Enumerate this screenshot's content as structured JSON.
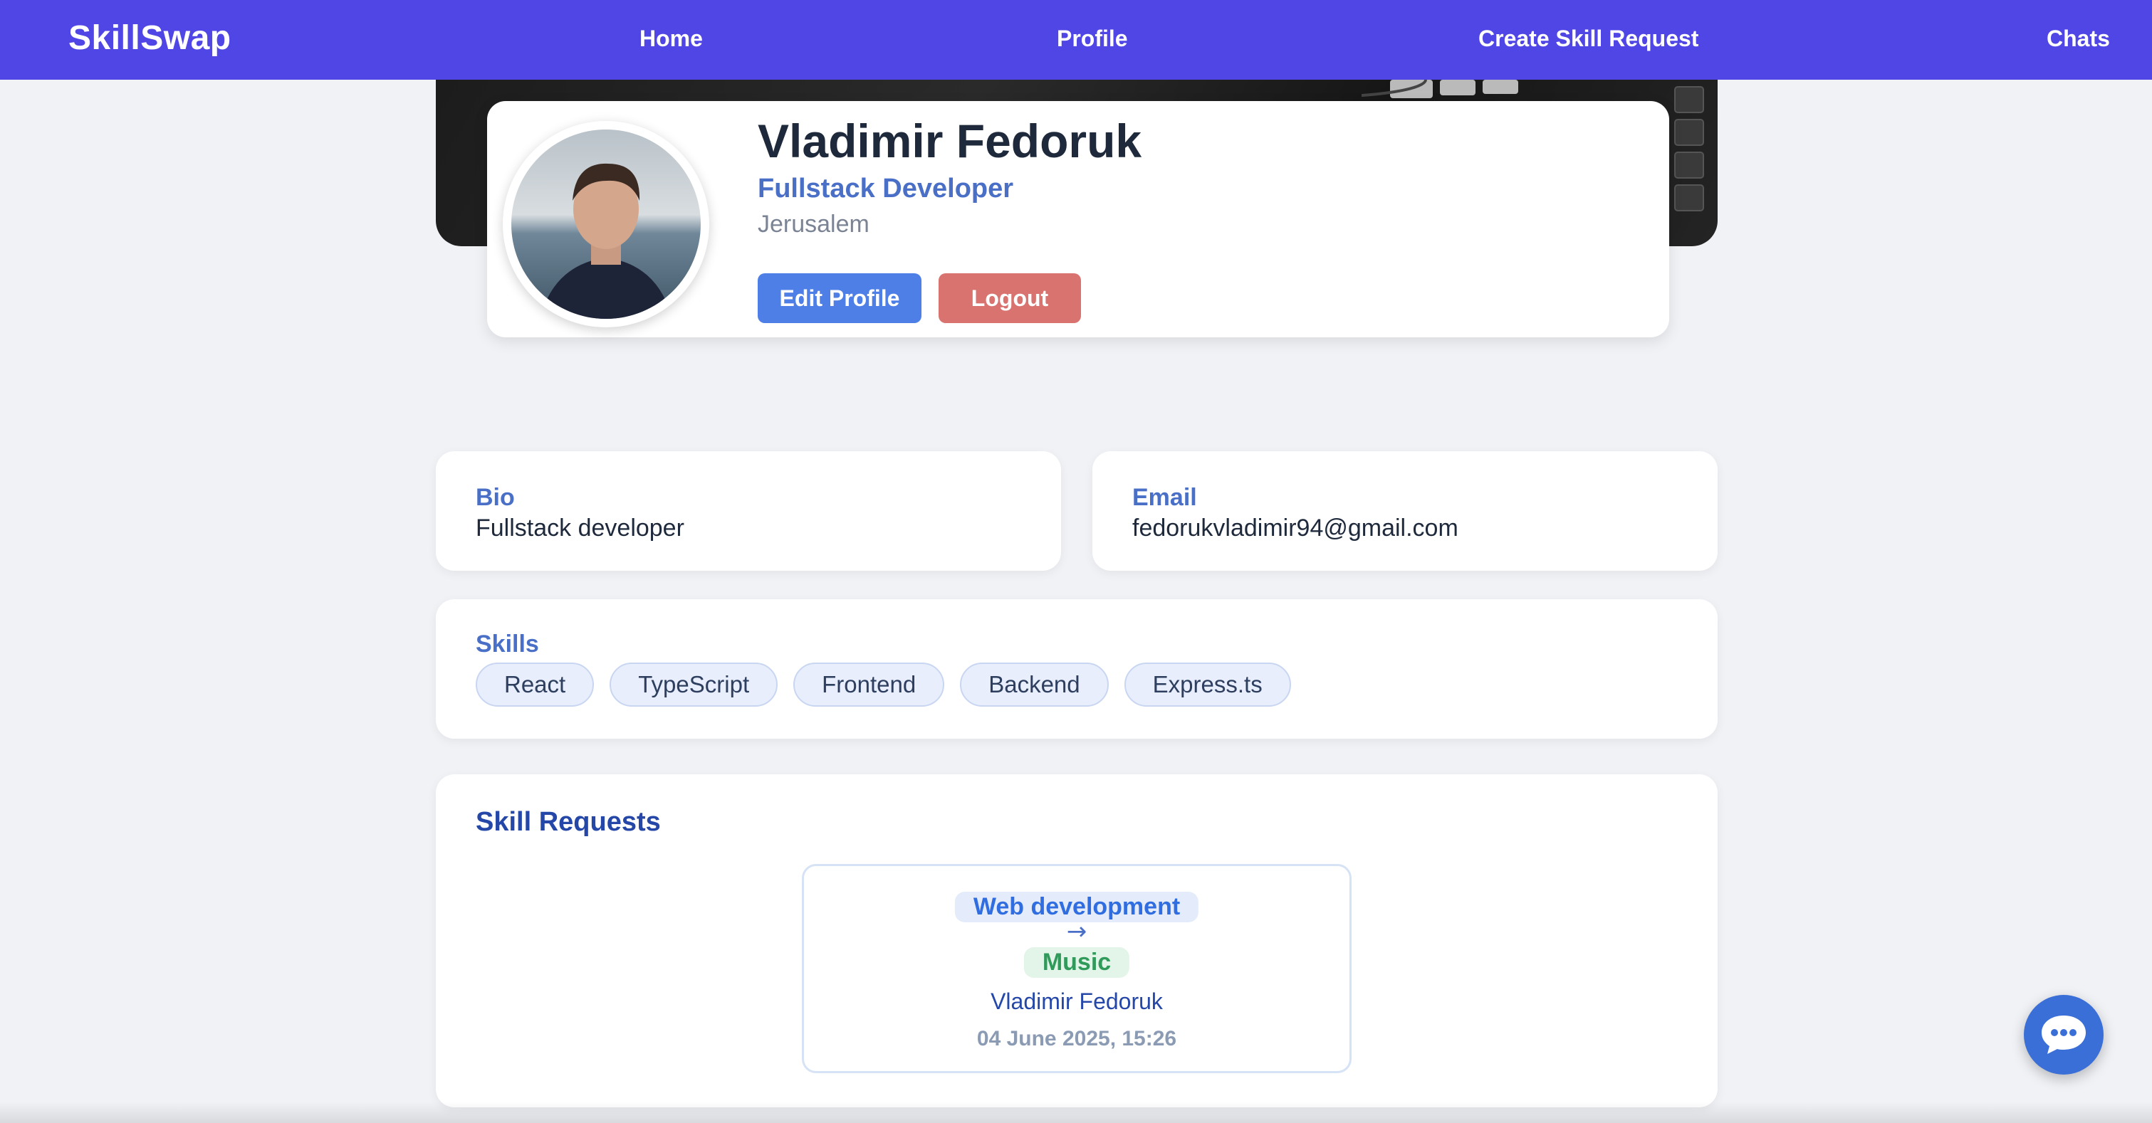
{
  "navbar": {
    "brand": "SkillSwap",
    "links": [
      "Home",
      "Profile",
      "Create Skill Request",
      "Chats"
    ]
  },
  "profile": {
    "name": "Vladimir Fedoruk",
    "role": "Fullstack Developer",
    "location": "Jerusalem",
    "edit_label": "Edit Profile",
    "logout_label": "Logout"
  },
  "bio": {
    "label": "Bio",
    "value": "Fullstack developer"
  },
  "email": {
    "label": "Email",
    "value": "fedorukvladimir94@gmail.com"
  },
  "skills": {
    "label": "Skills",
    "items": [
      "React",
      "TypeScript",
      "Frontend",
      "Backend",
      "Express.ts"
    ]
  },
  "requests": {
    "title": "Skill Requests",
    "items": [
      {
        "from": "Web development",
        "arrow": "→",
        "to": "Music",
        "user": "Vladimir Fedoruk",
        "date": "04 June 2025, 15:26"
      }
    ]
  },
  "colors": {
    "navbar": "#4f46e5",
    "accent": "#4a6fc7",
    "edit_button": "#4e7fe6",
    "logout_button": "#d9736f",
    "tag_from": "#2f6de0",
    "tag_to": "#2f9a5a"
  },
  "icons": {
    "chat_fab": "chat-bubble-icon"
  }
}
